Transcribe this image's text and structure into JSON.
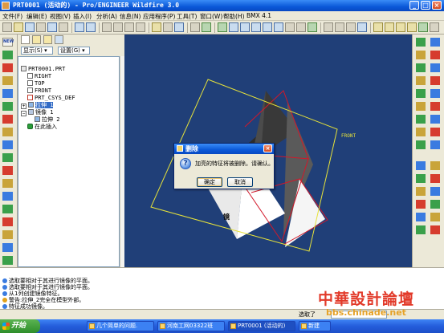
{
  "window": {
    "title": "PRT0001 (活动的) - Pro/ENGINEER Wildfire 3.0",
    "minimize": "_",
    "maximize": "□",
    "close": "×"
  },
  "menu": [
    "文件(F)",
    "编辑(E)",
    "视图(V)",
    "插入(I)",
    "分析(A)",
    "信息(N)",
    "应用程序(P)",
    "工具(T)",
    "窗口(W)",
    "帮助(H)",
    "BMX 4.1"
  ],
  "left_toolbar": {
    "new_label": "NEW"
  },
  "model_tree": {
    "show_dropdown": "显示(S) ▾",
    "settings_dropdown": "设置(G) ▾",
    "items": [
      {
        "label": "PRT0001.PRT"
      },
      {
        "label": "RIGHT"
      },
      {
        "label": "TOP"
      },
      {
        "label": "FRONT"
      },
      {
        "label": "PRT_CSYS_DEF"
      },
      {
        "label": "拉伸 1",
        "selected": true
      },
      {
        "label": "镜像 1"
      },
      {
        "label": "拉伸 2"
      },
      {
        "label": "在此插入"
      }
    ]
  },
  "viewport": {
    "plane_label": "FRONT",
    "background": "#203f78"
  },
  "messages": [
    {
      "text": "选取要相对于其进行镜像的平面。",
      "icon_color": "#3a7be0"
    },
    {
      "text": "选取要相对于其进行镜像的平面。",
      "icon_color": "#3a7be0"
    },
    {
      "text": "从1列创建镜像特征。",
      "icon_color": "#3a7be0"
    },
    {
      "text": "警告:拉伸_2完全在模型外部。",
      "icon_color": "#e2a21b"
    },
    {
      "text": "特征成功镜像。",
      "icon_color": "#3a7be0"
    }
  ],
  "statusbar": {
    "selected_text": "选取了"
  },
  "dialog": {
    "title": "删除",
    "message": "加亮的特征将被删除。请确认。",
    "ok": "确定",
    "cancel": "取消"
  },
  "taskbar": {
    "start": "开始",
    "items": [
      {
        "label": "几个简单的问题."
      },
      {
        "label": "河南工网03322班"
      },
      {
        "label": "PRT0001 (活动的)"
      },
      {
        "label": "新建"
      }
    ]
  },
  "watermark": {
    "chars": "中華設計論壇",
    "url": "bbs.chinade.net"
  }
}
